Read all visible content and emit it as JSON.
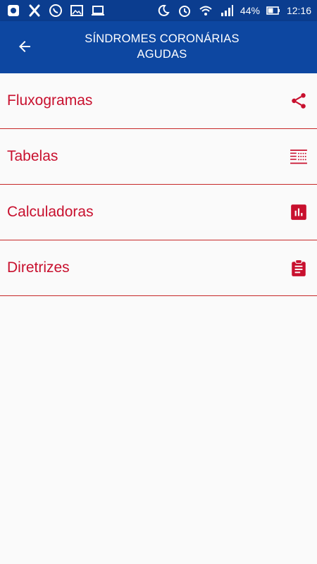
{
  "status_bar": {
    "battery_percent_label": "44%",
    "time": "12:16",
    "left_icons": [
      "app-icon",
      "shield-icon",
      "whatsapp-icon",
      "image-icon",
      "laptop-icon"
    ],
    "right_icons": [
      "do-not-disturb-icon",
      "alarm-icon",
      "wifi-icon",
      "signal-icon",
      "battery-icon"
    ]
  },
  "app_bar": {
    "title_line1": "SÍNDROMES CORONÁRIAS",
    "title_line2": "AGUDAS",
    "back_icon": "arrow-left-icon"
  },
  "menu": {
    "items": [
      {
        "label": "Fluxogramas",
        "icon": "share-icon"
      },
      {
        "label": "Tabelas",
        "icon": "table-icon"
      },
      {
        "label": "Calculadoras",
        "icon": "bar-chart-icon"
      },
      {
        "label": "Diretrizes",
        "icon": "clipboard-icon"
      }
    ]
  },
  "colors": {
    "status_bar_bg": "#0b3d8f",
    "app_bar_bg": "#0d47a1",
    "accent_red": "#c8102e",
    "background": "#fafafa"
  }
}
